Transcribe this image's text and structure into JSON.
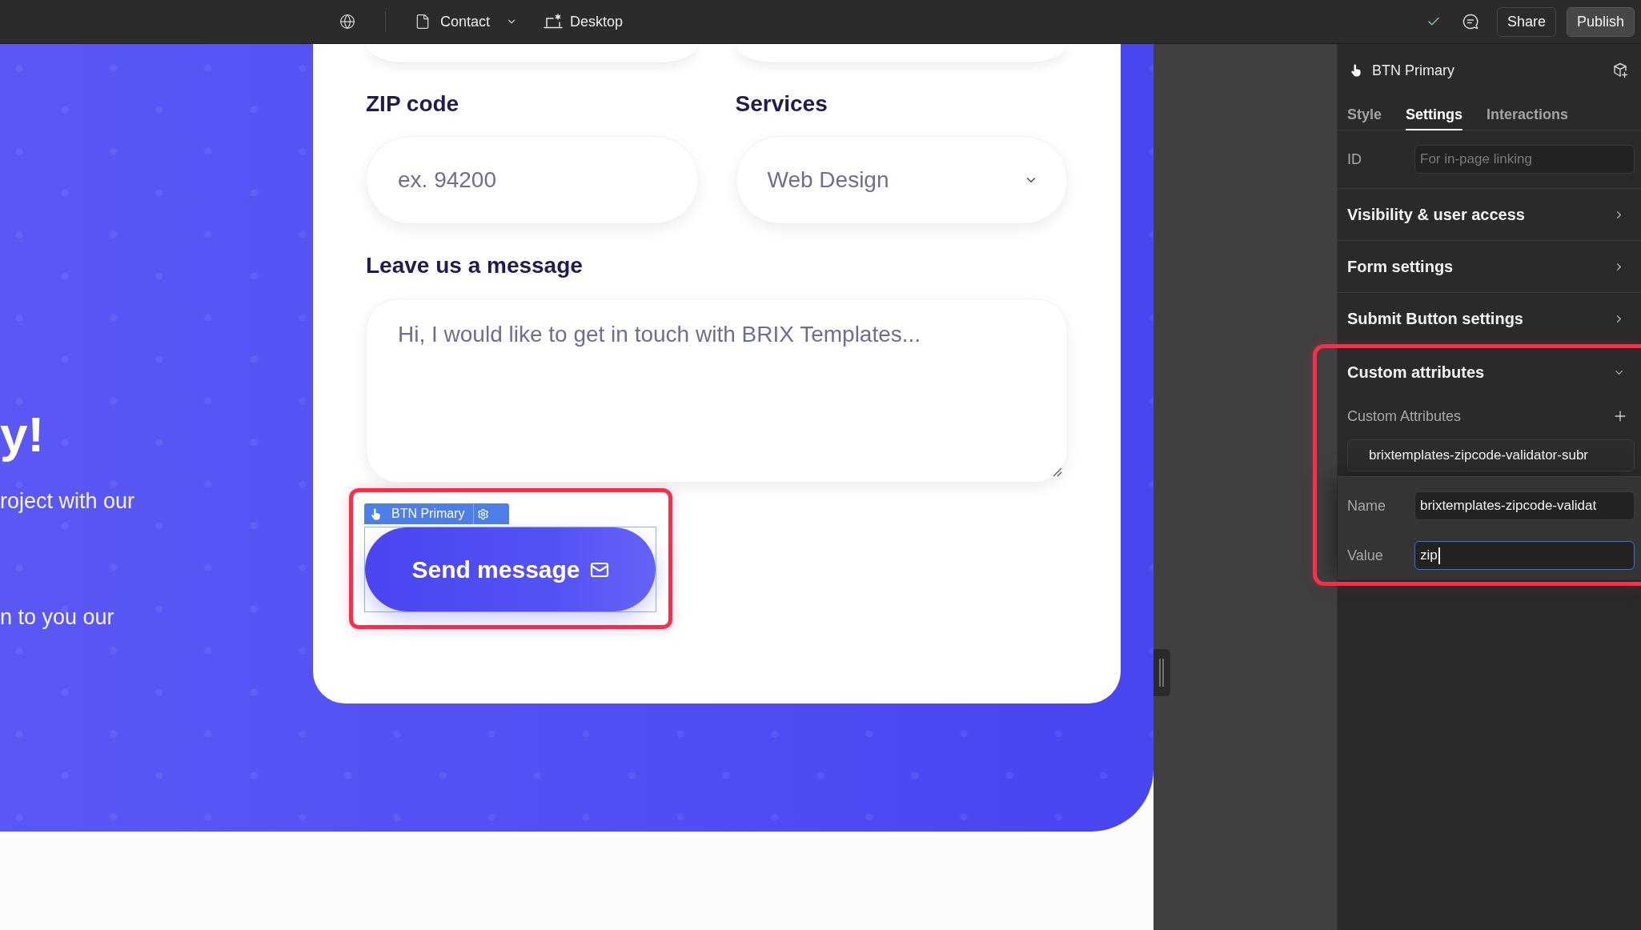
{
  "topbar": {
    "page": "Contact",
    "breakpoint": "Desktop",
    "actions": [
      {
        "label": "Share",
        "kind": "secondary"
      },
      {
        "label": "Publish",
        "kind": "primary"
      }
    ]
  },
  "canvas": {
    "hero": {
      "heading": "y!",
      "lines": [
        "roject with our",
        "n to you our"
      ]
    },
    "form": {
      "rows": [
        {
          "fields": [
            {
              "kind": "text",
              "label": "ZIP code",
              "placeholder": "ex. 94200"
            },
            {
              "kind": "select",
              "label": "Services",
              "value": "Web Design"
            }
          ]
        },
        {
          "fields": [
            {
              "kind": "textarea",
              "label": "Leave us a message",
              "placeholder": "Hi, I would like to get in touch with BRIX Templates..."
            }
          ]
        }
      ],
      "submit": {
        "label": "Send message",
        "element_label": "BTN Primary"
      }
    }
  },
  "inspector": {
    "element": "BTN Primary",
    "tabs": [
      {
        "label": "Style",
        "selected": false
      },
      {
        "label": "Settings",
        "selected": true
      },
      {
        "label": "Interactions",
        "selected": false
      }
    ],
    "id_field": {
      "label": "ID",
      "placeholder": "For in-page linking"
    },
    "sections": [
      {
        "title": "Visibility & user access",
        "expanded": false
      },
      {
        "title": "Form settings",
        "expanded": false
      },
      {
        "title": "Submit Button settings",
        "expanded": false
      },
      {
        "title": "Custom attributes",
        "expanded": true,
        "content": {
          "label": "Custom Attributes",
          "items": [
            "brixtemplates-zipcode-validator-subr"
          ],
          "editor": [
            {
              "label": "Name",
              "value": "brixtemplates-zipcode-validat",
              "focused": false
            },
            {
              "label": "Value",
              "value": "zip",
              "focused": true
            }
          ]
        }
      }
    ]
  }
}
